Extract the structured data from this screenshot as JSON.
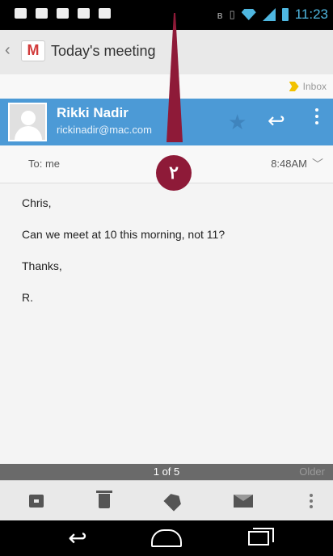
{
  "status_bar": {
    "time": "11:23"
  },
  "action_bar": {
    "title": "Today's meeting"
  },
  "label": {
    "text": "Inbox",
    "color": "#f2c200"
  },
  "sender": {
    "name": "Rikki Nadir",
    "email": "rickinadir@mac.com",
    "bar_color": "#4c9ad6"
  },
  "recipient": {
    "to": "To: me",
    "time": "8:48AM"
  },
  "callout": {
    "number": "٢",
    "color": "#8e1a38"
  },
  "message": {
    "lines": [
      "Chris,",
      "Can we meet at 10 this morning, not 11?",
      "Thanks,",
      "R."
    ]
  },
  "pager": {
    "count": "1 of 5",
    "older": "Older"
  },
  "icons": {
    "bottom": [
      "archive-icon",
      "trash-icon",
      "label-icon",
      "mark-unread-icon",
      "overflow-icon"
    ],
    "nav": [
      "back-icon",
      "home-icon",
      "recent-apps-icon"
    ]
  }
}
